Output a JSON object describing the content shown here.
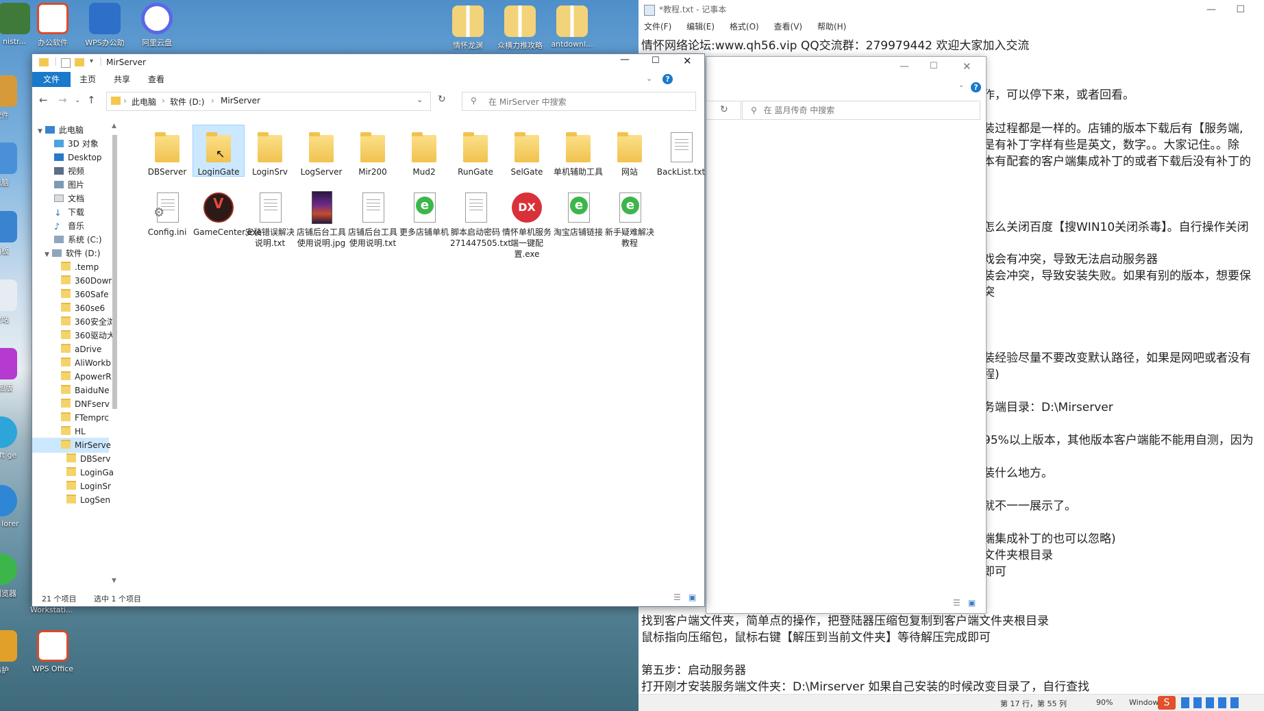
{
  "desktop": {
    "icons_top": [
      {
        "label": "nistr...",
        "color": "#3f7a3b"
      },
      {
        "label": "办公软件",
        "color": "#d94b2b"
      },
      {
        "label": "WPS办公助",
        "color": "#2e6fc9"
      },
      {
        "label": "阿里云盘",
        "color": "#5c67e8"
      }
    ],
    "icons_folders": [
      {
        "label": "情怀龙渊"
      },
      {
        "label": "众横力推攻略"
      },
      {
        "label": "antdownl..."
      }
    ],
    "icons_left": [
      {
        "label": "软件"
      },
      {
        "label": "电脑"
      },
      {
        "label": "面板"
      },
      {
        "label": "收站"
      },
      {
        "label": "送图版"
      },
      {
        "label": "osoft ge"
      },
      {
        "label": "rnet lorer"
      },
      {
        "label": "全浏览器"
      },
      {
        "label": "防护"
      }
    ],
    "wps_office": "WPS Office",
    "workstation": "Workstati..."
  },
  "notepad": {
    "title": "*教程.txt - 记事本",
    "menu": [
      "文件(F)",
      "编辑(E)",
      "格式(O)",
      "查看(V)",
      "帮助(H)"
    ],
    "lines": [
      "情怀网络论坛:www.qh56.vip  QQ交流群：279979442  欢迎大家加入交流",
      "作，可以停下来，或者回看。",
      "装过程都是一样的。店铺的版本下载后有【服务端,",
      "是有补丁字样有些是英文，数字。。大家记住。。除",
      "本有配套的客户端集成补丁的或者下载后没有补丁的",
      "怎么关闭百度【搜WIN10关闭杀毒】。自行操作关闭",
      "戏会有冲突，导致无法启动服务器",
      "装会冲突，导致安装失败。如果有别的版本，想要保",
      "突",
      "装经验尽量不要改变默认路径，如果是网吧或者没有",
      "程)",
      "务端目录：D:\\Mirserver",
      "95%以上版本，其他版本客户端能不能用自测，因为",
      "装什么地方。",
      "就不一一展示了。",
      "端集成补丁的也可以忽略)",
      "文件夹根目录",
      "即可",
      "找到客户端文件夹，简单点的操作，把登陆器压缩包复制到客户端文件夹根目录",
      "鼠标指向压缩包，鼠标右键【解压到当前文件夹】等待解压完成即可",
      "第五步：启动服务器",
      "打开刚才安装服务端文件夹：D:\\Mirserver  如果自己安装的时候改变目录了，自行查找"
    ],
    "status_pos": "第 17 行，第 55 列",
    "status_zoom": "90%",
    "status_eol": "Window"
  },
  "bg_explorer": {
    "search_placeholder": "在 蓝月传奇 中搜索"
  },
  "explorer": {
    "title": "MirServer",
    "tabs": [
      "文件",
      "主页",
      "共享",
      "查看"
    ],
    "breadcrumb": [
      "此电脑",
      "软件 (D:)",
      "MirServer"
    ],
    "search_placeholder": "在 MirServer 中搜索",
    "sidebar": [
      {
        "label": "此电脑",
        "indent": 0
      },
      {
        "label": "3D 对象",
        "indent": 1
      },
      {
        "label": "Desktop",
        "indent": 1
      },
      {
        "label": "视频",
        "indent": 1
      },
      {
        "label": "图片",
        "indent": 1
      },
      {
        "label": "文档",
        "indent": 1
      },
      {
        "label": "下载",
        "indent": 1
      },
      {
        "label": "音乐",
        "indent": 1
      },
      {
        "label": "系统 (C:)",
        "indent": 1
      },
      {
        "label": "软件 (D:)",
        "indent": 1
      },
      {
        "label": ".temp",
        "indent": 2
      },
      {
        "label": "360Dowr",
        "indent": 2
      },
      {
        "label": "360Safe",
        "indent": 2
      },
      {
        "label": "360se6",
        "indent": 2
      },
      {
        "label": "360安全浏",
        "indent": 2
      },
      {
        "label": "360驱动大",
        "indent": 2
      },
      {
        "label": "aDrive",
        "indent": 2
      },
      {
        "label": "AliWorkb",
        "indent": 2
      },
      {
        "label": "ApowerR",
        "indent": 2
      },
      {
        "label": "BaiduNe",
        "indent": 2
      },
      {
        "label": "DNFserv",
        "indent": 2
      },
      {
        "label": "FTemprc",
        "indent": 2
      },
      {
        "label": "HL",
        "indent": 2
      },
      {
        "label": "MirServe",
        "indent": 2,
        "selected": true
      },
      {
        "label": "DBServ",
        "indent": 3
      },
      {
        "label": "LoginGa",
        "indent": 3
      },
      {
        "label": "LoginSr",
        "indent": 3
      },
      {
        "label": "LogSen",
        "indent": 3
      }
    ],
    "files": [
      {
        "name": "DBServer",
        "kind": "folder"
      },
      {
        "name": "LoginGate",
        "kind": "folder",
        "selected": true
      },
      {
        "name": "LoginSrv",
        "kind": "folder"
      },
      {
        "name": "LogServer",
        "kind": "folder"
      },
      {
        "name": "Mir200",
        "kind": "folder"
      },
      {
        "name": "Mud2",
        "kind": "folder"
      },
      {
        "name": "RunGate",
        "kind": "folder"
      },
      {
        "name": "SelGate",
        "kind": "folder"
      },
      {
        "name": "单机辅助工具",
        "kind": "folder"
      },
      {
        "name": "网站",
        "kind": "folder"
      },
      {
        "name": "BackList.txt",
        "kind": "text"
      },
      {
        "name": "Config.ini",
        "kind": "ini"
      },
      {
        "name": "GameCenter.exe",
        "kind": "exe-game"
      },
      {
        "name": "安装错误解决说明.txt",
        "kind": "text"
      },
      {
        "name": "店铺后台工具使用说明.jpg",
        "kind": "image"
      },
      {
        "name": "店铺后台工具使用说明.txt",
        "kind": "text"
      },
      {
        "name": "更多店铺单机",
        "kind": "ie"
      },
      {
        "name": "脚本启动密码 271447505.txt",
        "kind": "text"
      },
      {
        "name": "情怀单机服务端一键配置.exe",
        "kind": "exe-dx"
      },
      {
        "name": "淘宝店铺链接",
        "kind": "ie"
      },
      {
        "name": "新手疑难解决教程",
        "kind": "ie"
      }
    ],
    "status_count": "21 个项目",
    "status_selected": "选中 1 个项目"
  },
  "colors": {
    "accent": "#1979ca",
    "selection": "#cce8ff",
    "folder": "#f4c850"
  }
}
